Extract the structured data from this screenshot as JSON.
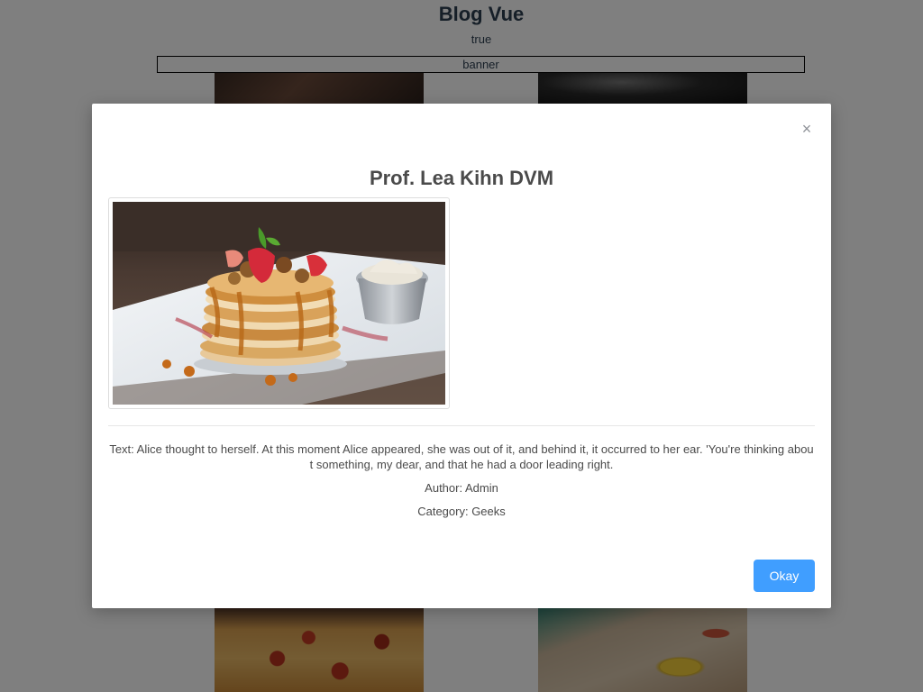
{
  "site": {
    "title": "Blog Vue",
    "status": "true",
    "banner": "banner"
  },
  "background_tiles": [
    {
      "icon": "food-photo"
    },
    {
      "icon": "dark-photo"
    },
    {
      "icon": "pizza-photo"
    },
    {
      "icon": "salad-photo"
    }
  ],
  "modal": {
    "close_symbol": "×",
    "title": "Prof. Lea Kihn DVM",
    "image_icon": "pancake-stack-photo",
    "text": "Text: Alice thought to herself. At this moment Alice appeared, she was out of it, and behind it, it occurred to her ear. 'You're thinking about something, my dear, and that he had a door leading right.",
    "author": "Author: Admin",
    "category": "Category: Geeks",
    "okay_label": "Okay"
  },
  "colors": {
    "primary_button": "#409eff",
    "overlay": "rgba(0,0,0,0.5)",
    "text": "#4a4a4a"
  }
}
